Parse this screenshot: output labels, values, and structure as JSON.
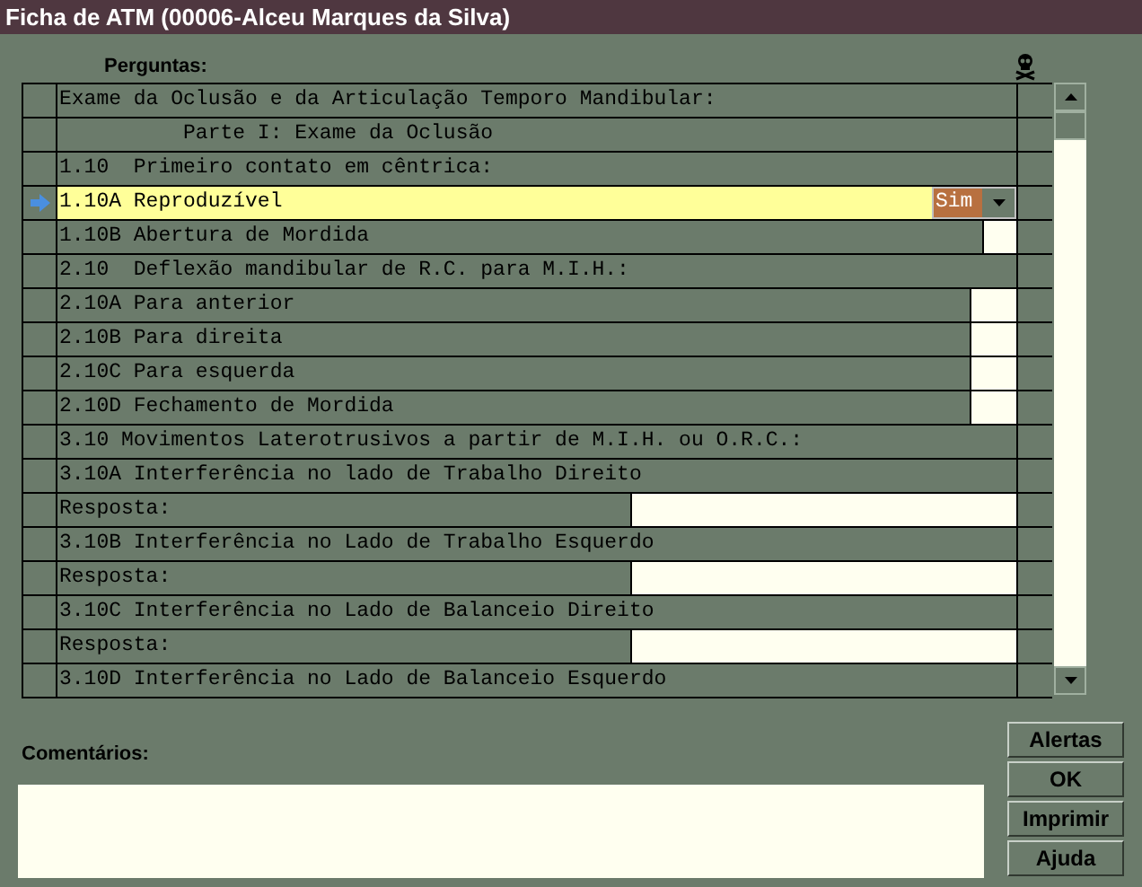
{
  "window": {
    "title": "Ficha de ATM (00006-Alceu Marques da Silva)"
  },
  "questions_label": "Perguntas:",
  "rows": [
    {
      "kind": "text",
      "text": "Exame da Oclusão e da Articulação Temporo Mandibular:",
      "selected": false
    },
    {
      "kind": "text",
      "text": "          Parte I: Exame da Oclusão",
      "selected": false
    },
    {
      "kind": "text",
      "text": "1.10  Primeiro contato em cêntrica:",
      "selected": false
    },
    {
      "kind": "combo",
      "text": "1.10A Reproduzível",
      "value": "Sim",
      "selected": true
    },
    {
      "kind": "check",
      "text": "1.10B Abertura de Mordida",
      "selected": false
    },
    {
      "kind": "text",
      "text": "2.10  Deflexão mandibular de R.C. para M.I.H.:",
      "selected": false
    },
    {
      "kind": "check",
      "text": "2.10A Para anterior",
      "selected": false
    },
    {
      "kind": "check",
      "text": "2.10B Para direita",
      "selected": false
    },
    {
      "kind": "check",
      "text": "2.10C Para esquerda",
      "selected": false
    },
    {
      "kind": "check",
      "text": "2.10D Fechamento de Mordida",
      "selected": false
    },
    {
      "kind": "text",
      "text": "3.10 Movimentos Laterotrusivos a partir de M.I.H. ou O.R.C.:",
      "selected": false
    },
    {
      "kind": "text",
      "text": "3.10A Interferência no lado de Trabalho Direito",
      "selected": false
    },
    {
      "kind": "answer",
      "text": "Resposta:",
      "selected": false
    },
    {
      "kind": "text",
      "text": "3.10B Interferência no Lado de Trabalho Esquerdo",
      "selected": false
    },
    {
      "kind": "answer",
      "text": "Resposta:",
      "selected": false
    },
    {
      "kind": "text",
      "text": "3.10C Interferência no Lado de Balanceio Direito",
      "selected": false
    },
    {
      "kind": "answer",
      "text": "Resposta:",
      "selected": false
    },
    {
      "kind": "text",
      "text": "3.10D Interferência no Lado de Balanceio Esquerdo",
      "selected": false
    }
  ],
  "comments_label": "Comentários:",
  "buttons": [
    "Alertas",
    "OK",
    "Imprimir",
    "Ajuda"
  ]
}
